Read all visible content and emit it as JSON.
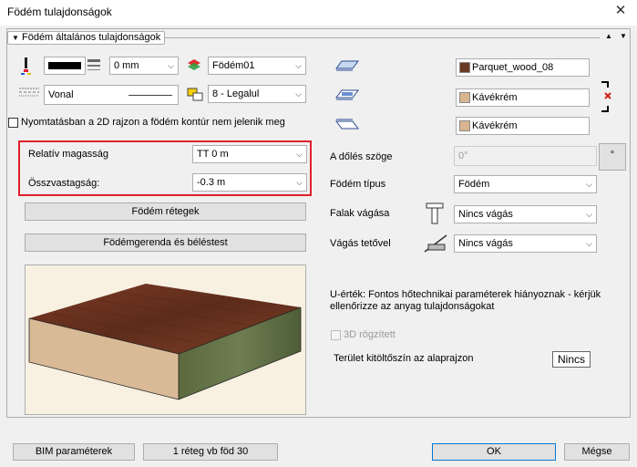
{
  "window": {
    "title": "Födém tulajdonságok",
    "close_glyph": "✕"
  },
  "section": {
    "title": "Födém általános tulajdonságok",
    "expand_glyph": "▼"
  },
  "top": {
    "pen_width": "0 mm",
    "layer": "Födém01",
    "line_type": "Vonal",
    "level": "8 - Legalul"
  },
  "print_hide_label": "Nyomtatásban a 2D rajzon a födém kontúr nem jelenik meg",
  "relative_height": {
    "label": "Relatív magasság",
    "value": "TT 0 m"
  },
  "total_thickness": {
    "label": "Összvastagság:",
    "value": "-0.3 m"
  },
  "buttons": {
    "layers": "Födém rétegek",
    "beams": "Födémgerenda és béléstest",
    "bim": "BIM paraméterek",
    "layer_info": "1 réteg vb föd 30",
    "ok": "OK",
    "cancel": "Mégse",
    "none": "Nincs"
  },
  "materials": [
    {
      "name": "Parquet_wood_08",
      "color": "#6b3a24"
    },
    {
      "name": "Kávékrém",
      "color": "#d8b48f"
    },
    {
      "name": "Kávékrém",
      "color": "#d8b48f"
    }
  ],
  "slope": {
    "label": "A dőlés szöge",
    "value": "0°",
    "unit": "°"
  },
  "slab_type": {
    "label": "Födém típus",
    "value": "Födém"
  },
  "wall_cut": {
    "label": "Falak vágása",
    "value": "Nincs vágás"
  },
  "roof_cut": {
    "label": "Vágás tetővel",
    "value": "Nincs vágás"
  },
  "u_value_note": "U-érték: Fontos hőtechnikai paraméterek hiányoznak - kérjük ellenőrizze az anyag tulajdonságokat",
  "fixed_3d": "3D rögzített",
  "area_fill_label": "Terület kitöltőszín az alaprajzon"
}
